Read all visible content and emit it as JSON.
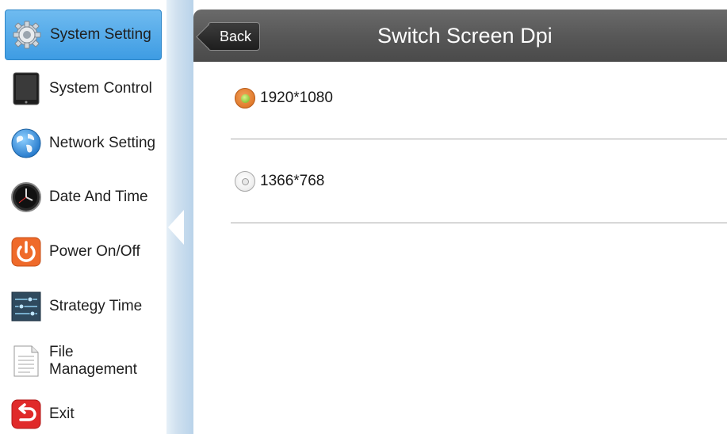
{
  "sidebar": {
    "items": [
      {
        "label": "System Setting",
        "icon": "gear-icon",
        "active": true
      },
      {
        "label": "System Control",
        "icon": "tablet-icon",
        "active": false
      },
      {
        "label": "Network Setting",
        "icon": "globe-icon",
        "active": false
      },
      {
        "label": "Date And Time",
        "icon": "clock-icon",
        "active": false
      },
      {
        "label": "Power On/Off",
        "icon": "power-icon",
        "active": false
      },
      {
        "label": "Strategy Time",
        "icon": "sliders-icon",
        "active": false
      },
      {
        "label": "File Management",
        "icon": "document-icon",
        "active": false
      },
      {
        "label": "Exit",
        "icon": "exit-icon",
        "active": false
      }
    ],
    "active_color": "#3e9ce3"
  },
  "header": {
    "back_label": "Back",
    "title": "Switch Screen Dpi"
  },
  "options": [
    {
      "label": "1920*1080",
      "selected": true
    },
    {
      "label": "1366*768",
      "selected": false
    }
  ],
  "colors": {
    "titlebar": "#585858",
    "radio_on": "#e07a2c",
    "radio_on_dot": "#8ec63a"
  }
}
